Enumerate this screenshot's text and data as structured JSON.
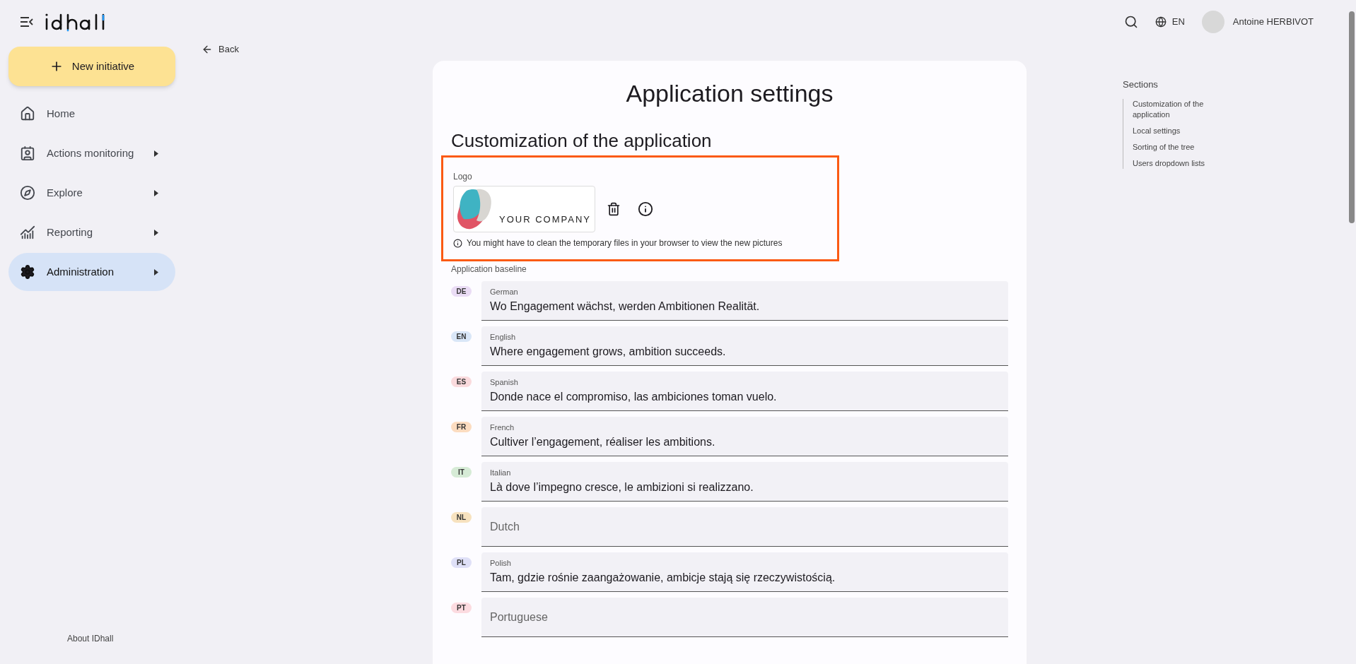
{
  "header": {
    "language": "EN",
    "user_name": "Antoine HERBIVOT"
  },
  "sidebar": {
    "new_button": "New initiative",
    "items": [
      {
        "label": "Home",
        "has_submenu": false,
        "selected": false
      },
      {
        "label": "Actions monitoring",
        "has_submenu": true,
        "selected": false
      },
      {
        "label": "Explore",
        "has_submenu": true,
        "selected": false
      },
      {
        "label": "Reporting",
        "has_submenu": true,
        "selected": false
      },
      {
        "label": "Administration",
        "has_submenu": true,
        "selected": true
      }
    ],
    "footer": "About IDhall"
  },
  "back": "Back",
  "page": {
    "title": "Application settings",
    "section_title": "Customization of the application",
    "logo": {
      "label": "Logo",
      "company_text": "YOUR COMPANY",
      "hint": "You might have to clean the temporary files in your browser to view the new pictures",
      "highlighted": true
    },
    "baseline_label": "Application baseline",
    "languages": [
      {
        "code": "DE",
        "color": "#eadcf5",
        "label": "German",
        "value": "Wo Engagement wächst, werden Ambitionen Realität."
      },
      {
        "code": "EN",
        "color": "#d9e6f7",
        "label": "English",
        "value": "Where engagement grows, ambition succeeds."
      },
      {
        "code": "ES",
        "color": "#fadadd",
        "label": "Spanish",
        "value": "Donde nace el compromiso, las ambiciones toman vuelo."
      },
      {
        "code": "FR",
        "color": "#fcdcc0",
        "label": "French",
        "value": "Cultiver l’engagement, réaliser les ambitions."
      },
      {
        "code": "IT",
        "color": "#d6ebd6",
        "label": "Italian",
        "value": "Là dove l’impegno cresce, le ambizioni si realizzano."
      },
      {
        "code": "NL",
        "color": "#f7e2bf",
        "placeholder": "Dutch"
      },
      {
        "code": "PL",
        "color": "#dfe0f7",
        "label": "Polish",
        "value": "Tam, gdzie rośnie zaangażowanie, ambicje stają się rzeczywistością."
      },
      {
        "code": "PT",
        "color": "#fcdbe0",
        "placeholder": "Portuguese"
      }
    ]
  },
  "toc": {
    "title": "Sections",
    "items": [
      "Customization of the application",
      "Local settings",
      "Sorting of the tree",
      "Users dropdown lists"
    ]
  }
}
